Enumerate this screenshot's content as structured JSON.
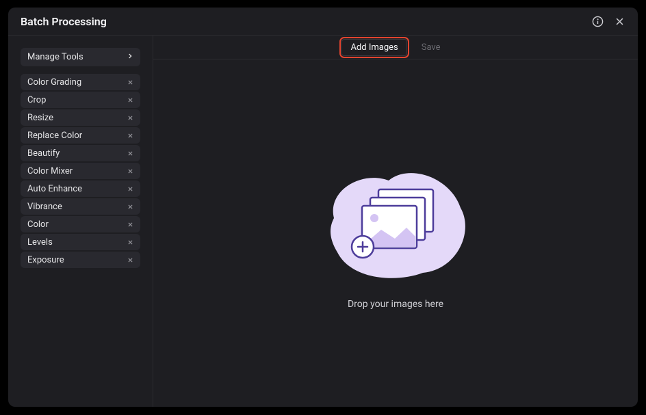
{
  "header": {
    "title": "Batch Processing"
  },
  "sidebar": {
    "manage_label": "Manage Tools",
    "tools": [
      {
        "label": "Color Grading"
      },
      {
        "label": "Crop"
      },
      {
        "label": "Resize"
      },
      {
        "label": "Replace Color"
      },
      {
        "label": "Beautify"
      },
      {
        "label": "Color Mixer"
      },
      {
        "label": "Auto Enhance"
      },
      {
        "label": "Vibrance"
      },
      {
        "label": "Color"
      },
      {
        "label": "Levels"
      },
      {
        "label": "Exposure"
      }
    ]
  },
  "toolbar": {
    "add_images_label": "Add Images",
    "save_label": "Save"
  },
  "main": {
    "drop_text": "Drop your images here"
  },
  "colors": {
    "highlight": "#e2442f",
    "illustration_bg": "#e4d9f9",
    "illustration_stroke": "#4d3d9b",
    "illustration_fill": "#d4c4f3"
  }
}
